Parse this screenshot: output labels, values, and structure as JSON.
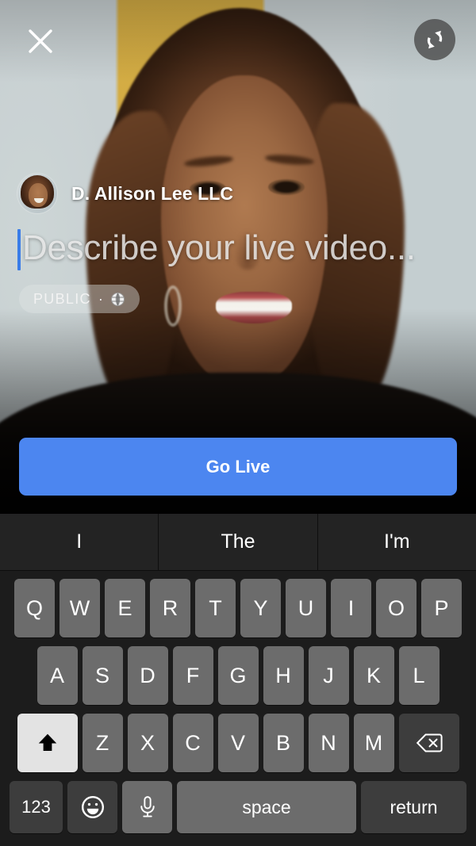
{
  "app": {
    "screen_name": "Facebook Live video composer"
  },
  "topbar": {
    "close_icon": "close-icon",
    "flip_camera_icon": "camera-flip-icon"
  },
  "composer": {
    "avatar_alt": "profile photo of D. Allison Lee",
    "author_name": "D. Allison Lee LLC",
    "description_value": "",
    "description_placeholder": "Describe your live video...",
    "privacy": {
      "label": "PUBLIC",
      "separator": "·",
      "icon": "globe-icon"
    }
  },
  "actions": {
    "go_live_label": "Go Live",
    "go_live_color": "#4c86f0"
  },
  "keyboard": {
    "predictions": [
      "I",
      "The",
      "I'm"
    ],
    "row1": [
      "Q",
      "W",
      "E",
      "R",
      "T",
      "Y",
      "U",
      "I",
      "O",
      "P"
    ],
    "row2": [
      "A",
      "S",
      "D",
      "F",
      "G",
      "H",
      "J",
      "K",
      "L"
    ],
    "row3": [
      "Z",
      "X",
      "C",
      "V",
      "B",
      "N",
      "M"
    ],
    "shift_icon": "shift-arrow-icon",
    "shift_active": true,
    "backspace_icon": "backspace-icon",
    "numbers_label": "123",
    "emoji_icon": "emoji-smiley-icon",
    "dictation_icon": "microphone-icon",
    "space_label": "space",
    "return_label": "return"
  }
}
